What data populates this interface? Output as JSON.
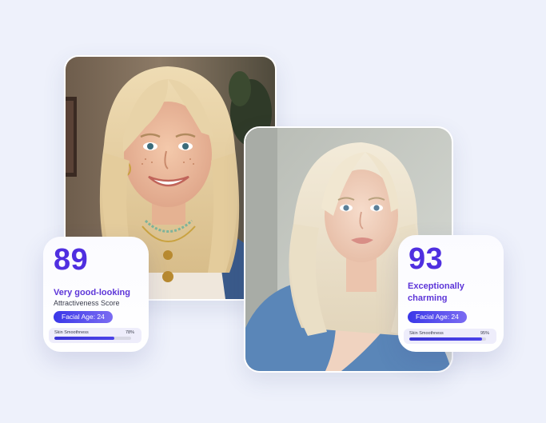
{
  "profiles": [
    {
      "score": "89",
      "verdict": "Very good-looking",
      "sublabel": "Attractiveness Score",
      "facial_age": "Facial Age: 24",
      "metric": {
        "name": "Skin Smoothness",
        "percent_label": "78%",
        "value": 78
      }
    },
    {
      "score": "93",
      "verdict": "Exceptionally charming",
      "facial_age": "Facial Age: 24",
      "metric": {
        "name": "Skin Smoothness",
        "percent_label": "95%",
        "value": 95
      }
    }
  ],
  "colors": {
    "background": "#eef1fb",
    "accent": "#4f2fe0",
    "pill_start": "#3a37e8",
    "pill_end": "#7b6cf2"
  }
}
